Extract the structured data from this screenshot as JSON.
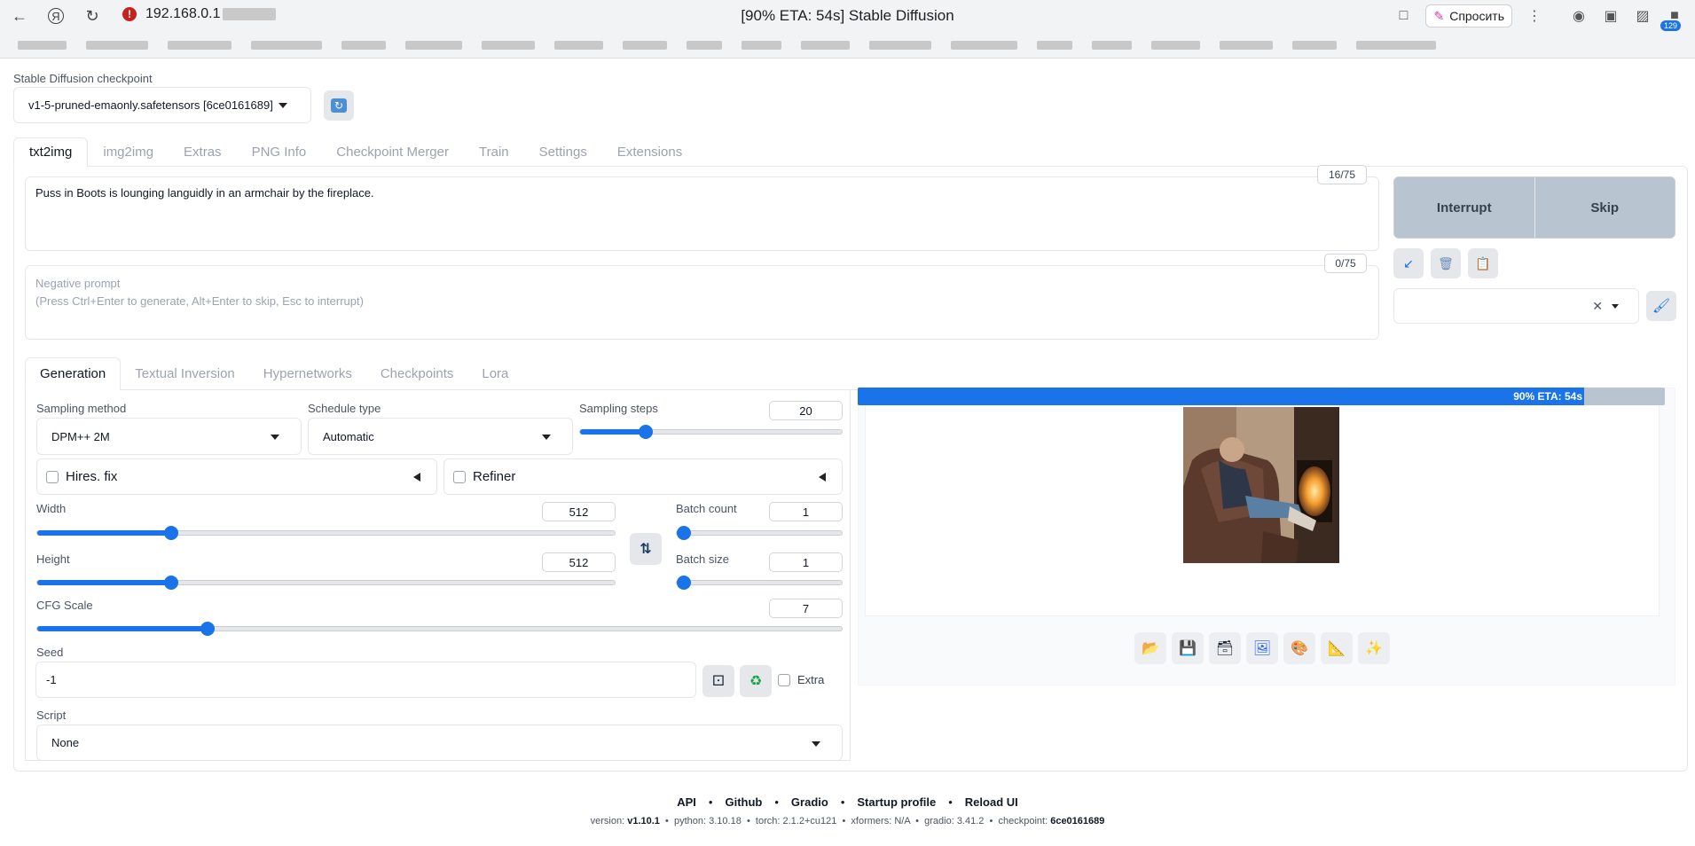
{
  "browser": {
    "address": "192.168.0.1",
    "tab_title": "[90% ETA: 54s] Stable Diffusion",
    "ask_label": "Спросить",
    "badge_count": "129"
  },
  "checkpoint": {
    "label": "Stable Diffusion checkpoint",
    "value": "v1-5-pruned-emaonly.safetensors [6ce0161689]"
  },
  "main_tabs": [
    "txt2img",
    "img2img",
    "Extras",
    "PNG Info",
    "Checkpoint Merger",
    "Train",
    "Settings",
    "Extensions"
  ],
  "prompt": {
    "text": "Puss in Boots is lounging languidly in an armchair by the fireplace.",
    "counter": "16/75"
  },
  "negative_prompt": {
    "placeholder_line1": "Negative prompt",
    "placeholder_line2": "(Press Ctrl+Enter to generate, Alt+Enter to skip, Esc to interrupt)",
    "counter": "0/75"
  },
  "actions": {
    "interrupt": "Interrupt",
    "skip": "Skip"
  },
  "sub_tabs": [
    "Generation",
    "Textual Inversion",
    "Hypernetworks",
    "Checkpoints",
    "Lora"
  ],
  "generation": {
    "sampling_method_label": "Sampling method",
    "sampling_method": "DPM++ 2M",
    "schedule_type_label": "Schedule type",
    "schedule_type": "Automatic",
    "sampling_steps_label": "Sampling steps",
    "sampling_steps": "20",
    "sampling_steps_fraction": 0.25,
    "hires_fix": "Hires. fix",
    "refiner": "Refiner",
    "width_label": "Width",
    "width": "512",
    "width_fraction": 0.232,
    "height_label": "Height",
    "height": "512",
    "height_fraction": 0.232,
    "batch_count_label": "Batch count",
    "batch_count": "1",
    "batch_size_label": "Batch size",
    "batch_size": "1",
    "cfg_label": "CFG Scale",
    "cfg": "7",
    "cfg_fraction": 0.212,
    "seed_label": "Seed",
    "seed": "-1",
    "extra_label": "Extra",
    "script_label": "Script",
    "script": "None"
  },
  "output": {
    "progress_text": "90% ETA: 54s",
    "progress_fraction": 0.9
  },
  "footer": {
    "links": [
      "API",
      "Github",
      "Gradio",
      "Startup profile",
      "Reload UI"
    ],
    "version_label": "version:",
    "version": "v1.10.1",
    "python": "python: 3.10.18",
    "torch": "torch: 2.1.2+cu121",
    "xformers": "xformers: N/A",
    "gradio": "gradio: 3.41.2",
    "checkpoint_label": "checkpoint:",
    "checkpoint": "6ce0161689"
  }
}
